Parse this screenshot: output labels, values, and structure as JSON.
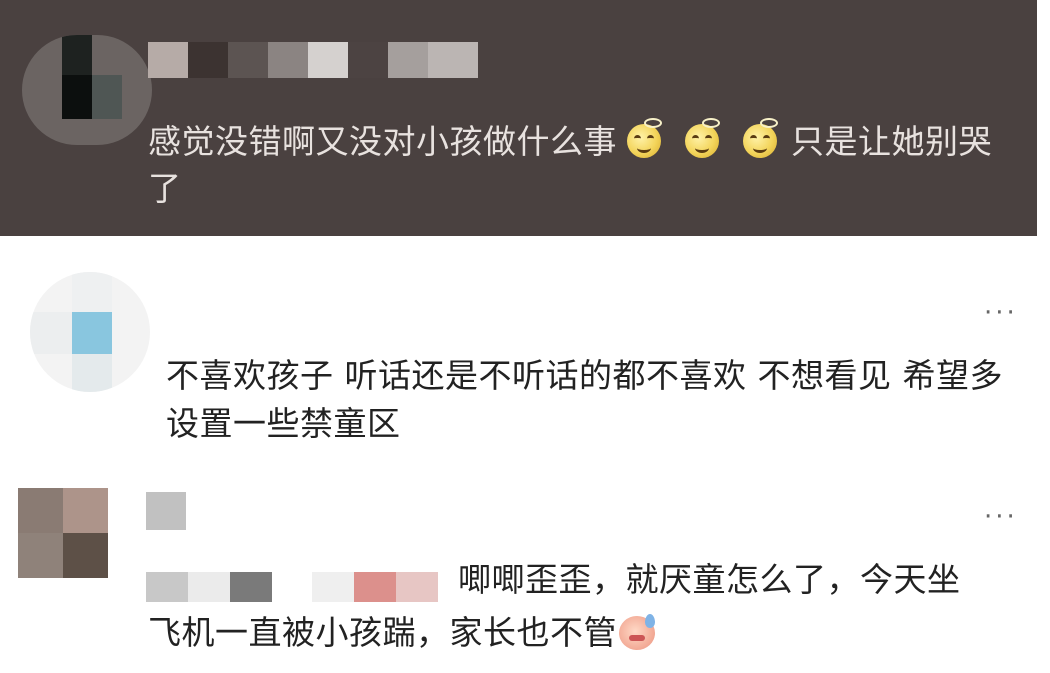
{
  "comments": [
    {
      "text_before": "感觉没错啊又没对小孩做什么事",
      "text_after": "只是让她别哭了",
      "emojis": [
        "smile-halo-emoji",
        "smile-halo-emoji",
        "smile-halo-emoji"
      ]
    },
    {
      "text": "不喜欢孩子 听话还是不听话的都不喜欢 不想看见 希望多设置一些禁童区",
      "more": "···"
    },
    {
      "text_line1": "唧唧歪歪，就厌童怎么了，今天坐",
      "text_line2": "飞机一直被小孩踹，家长也不管",
      "emoji": "sweat-face-emoji",
      "more": "···"
    }
  ]
}
